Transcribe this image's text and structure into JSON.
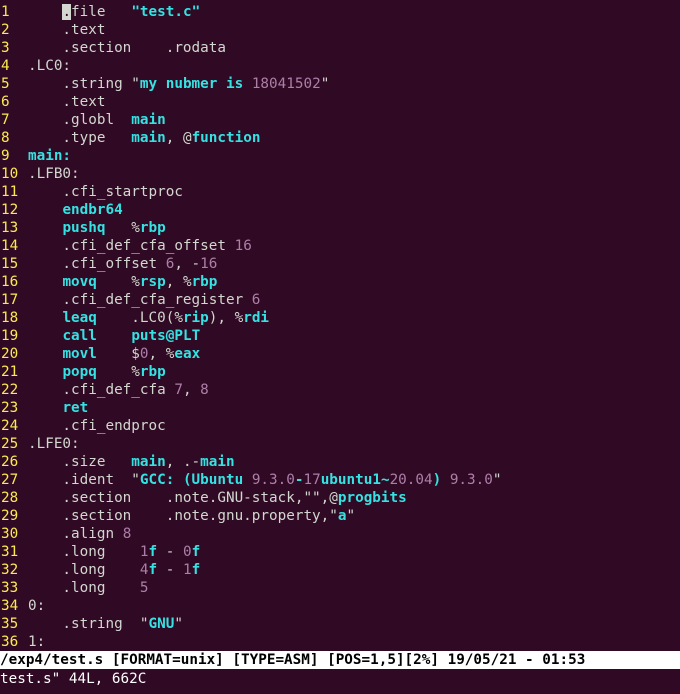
{
  "colors": {
    "background": "#300a24",
    "line_number": "#fce94f",
    "text": "#d3d7cf",
    "keyword": "#34e2e2",
    "number": "#ad7fa8",
    "statusbar_bg": "#ffffff",
    "statusbar_fg": "#000000"
  },
  "lines": [
    {
      "n": "1",
      "segs": [
        {
          "t": "    "
        },
        {
          "t": ".",
          "c": "cursor"
        },
        {
          "t": "file   "
        },
        {
          "t": "\"test.c\"",
          "c": "kw"
        }
      ]
    },
    {
      "n": "2",
      "segs": [
        {
          "t": "    .text"
        }
      ]
    },
    {
      "n": "3",
      "segs": [
        {
          "t": "    .section    .rodata"
        }
      ]
    },
    {
      "n": "4",
      "segs": [
        {
          "t": ".LC0:"
        }
      ]
    },
    {
      "n": "5",
      "segs": [
        {
          "t": "    .string \""
        },
        {
          "t": "my nubmer is ",
          "c": "kw"
        },
        {
          "t": "18041502",
          "c": "num"
        },
        {
          "t": "\""
        }
      ]
    },
    {
      "n": "6",
      "segs": [
        {
          "t": "    .text"
        }
      ]
    },
    {
      "n": "7",
      "segs": [
        {
          "t": "    .globl  "
        },
        {
          "t": "main",
          "c": "kw"
        }
      ]
    },
    {
      "n": "8",
      "segs": [
        {
          "t": "    .type   "
        },
        {
          "t": "main",
          "c": "kw"
        },
        {
          "t": ", @"
        },
        {
          "t": "function",
          "c": "kw"
        }
      ]
    },
    {
      "n": "9",
      "segs": [
        {
          "t": "main:",
          "c": "kw"
        }
      ]
    },
    {
      "n": "10",
      "segs": [
        {
          "t": ".LFB0:"
        }
      ]
    },
    {
      "n": "11",
      "segs": [
        {
          "t": "    .cfi_startproc"
        }
      ]
    },
    {
      "n": "12",
      "segs": [
        {
          "t": "    "
        },
        {
          "t": "endbr64",
          "c": "kw"
        }
      ]
    },
    {
      "n": "13",
      "segs": [
        {
          "t": "    "
        },
        {
          "t": "pushq",
          "c": "kw"
        },
        {
          "t": "   %"
        },
        {
          "t": "rbp",
          "c": "kw"
        }
      ]
    },
    {
      "n": "14",
      "segs": [
        {
          "t": "    .cfi_def_cfa_offset "
        },
        {
          "t": "16",
          "c": "num"
        }
      ]
    },
    {
      "n": "15",
      "segs": [
        {
          "t": "    .cfi_offset "
        },
        {
          "t": "6",
          "c": "num"
        },
        {
          "t": ", -"
        },
        {
          "t": "16",
          "c": "num"
        }
      ]
    },
    {
      "n": "16",
      "segs": [
        {
          "t": "    "
        },
        {
          "t": "movq",
          "c": "kw"
        },
        {
          "t": "    %"
        },
        {
          "t": "rsp",
          "c": "kw"
        },
        {
          "t": ", %"
        },
        {
          "t": "rbp",
          "c": "kw"
        }
      ]
    },
    {
      "n": "17",
      "segs": [
        {
          "t": "    .cfi_def_cfa_register "
        },
        {
          "t": "6",
          "c": "num"
        }
      ]
    },
    {
      "n": "18",
      "segs": [
        {
          "t": "    "
        },
        {
          "t": "leaq",
          "c": "kw"
        },
        {
          "t": "    .LC0(%"
        },
        {
          "t": "rip",
          "c": "kw"
        },
        {
          "t": "), %"
        },
        {
          "t": "rdi",
          "c": "kw"
        }
      ]
    },
    {
      "n": "19",
      "segs": [
        {
          "t": "    "
        },
        {
          "t": "call",
          "c": "kw"
        },
        {
          "t": "    "
        },
        {
          "t": "puts@PLT",
          "c": "kw"
        }
      ]
    },
    {
      "n": "20",
      "segs": [
        {
          "t": "    "
        },
        {
          "t": "movl",
          "c": "kw"
        },
        {
          "t": "    $"
        },
        {
          "t": "0",
          "c": "num"
        },
        {
          "t": ", %"
        },
        {
          "t": "eax",
          "c": "kw"
        }
      ]
    },
    {
      "n": "21",
      "segs": [
        {
          "t": "    "
        },
        {
          "t": "popq",
          "c": "kw"
        },
        {
          "t": "    %"
        },
        {
          "t": "rbp",
          "c": "kw"
        }
      ]
    },
    {
      "n": "22",
      "segs": [
        {
          "t": "    .cfi_def_cfa "
        },
        {
          "t": "7",
          "c": "num"
        },
        {
          "t": ", "
        },
        {
          "t": "8",
          "c": "num"
        }
      ]
    },
    {
      "n": "23",
      "segs": [
        {
          "t": "    "
        },
        {
          "t": "ret",
          "c": "kw"
        }
      ]
    },
    {
      "n": "24",
      "segs": [
        {
          "t": "    .cfi_endproc"
        }
      ]
    },
    {
      "n": "25",
      "segs": [
        {
          "t": ".LFE0:"
        }
      ]
    },
    {
      "n": "26",
      "segs": [
        {
          "t": "    .size   "
        },
        {
          "t": "main",
          "c": "kw"
        },
        {
          "t": ", .-"
        },
        {
          "t": "main",
          "c": "kw"
        }
      ]
    },
    {
      "n": "27",
      "segs": [
        {
          "t": "    .ident  \""
        },
        {
          "t": "GCC: (Ubuntu ",
          "c": "kw"
        },
        {
          "t": "9.3.0",
          "c": "num"
        },
        {
          "t": "-",
          "c": "kw"
        },
        {
          "t": "17",
          "c": "num"
        },
        {
          "t": "ubuntu1",
          "c": "kw"
        },
        {
          "t": "~",
          "c": "kw"
        },
        {
          "t": "20.04",
          "c": "num"
        },
        {
          "t": ") ",
          "c": "kw"
        },
        {
          "t": "9.3.0",
          "c": "num"
        },
        {
          "t": "\""
        }
      ]
    },
    {
      "n": "28",
      "segs": [
        {
          "t": "    .section    .note.GNU-stack,\"\",@"
        },
        {
          "t": "progbits",
          "c": "kw"
        }
      ]
    },
    {
      "n": "29",
      "segs": [
        {
          "t": "    .section    .note.gnu.property,\""
        },
        {
          "t": "a",
          "c": "kw"
        },
        {
          "t": "\""
        }
      ]
    },
    {
      "n": "30",
      "segs": [
        {
          "t": "    .align "
        },
        {
          "t": "8",
          "c": "num"
        }
      ]
    },
    {
      "n": "31",
      "segs": [
        {
          "t": "    .long    "
        },
        {
          "t": "1",
          "c": "num"
        },
        {
          "t": "f",
          "c": "kw"
        },
        {
          "t": " - "
        },
        {
          "t": "0",
          "c": "num"
        },
        {
          "t": "f",
          "c": "kw"
        }
      ]
    },
    {
      "n": "32",
      "segs": [
        {
          "t": "    .long    "
        },
        {
          "t": "4",
          "c": "num"
        },
        {
          "t": "f",
          "c": "kw"
        },
        {
          "t": " - "
        },
        {
          "t": "1",
          "c": "num"
        },
        {
          "t": "f",
          "c": "kw"
        }
      ]
    },
    {
      "n": "33",
      "segs": [
        {
          "t": "    .long    "
        },
        {
          "t": "5",
          "c": "num"
        }
      ]
    },
    {
      "n": "34",
      "segs": [
        {
          "t": "0:"
        }
      ]
    },
    {
      "n": "35",
      "segs": [
        {
          "t": "    .string  \""
        },
        {
          "t": "GNU",
          "c": "kw"
        },
        {
          "t": "\""
        }
      ]
    },
    {
      "n": "36",
      "segs": [
        {
          "t": "1:"
        }
      ]
    }
  ],
  "statusbar": {
    "text": "/exp4/test.s [FORMAT=unix] [TYPE=ASM] [POS=1,5][2%] 19/05/21 - 01:53"
  },
  "cmdline": {
    "text": "test.s\" 44L, 662C"
  }
}
